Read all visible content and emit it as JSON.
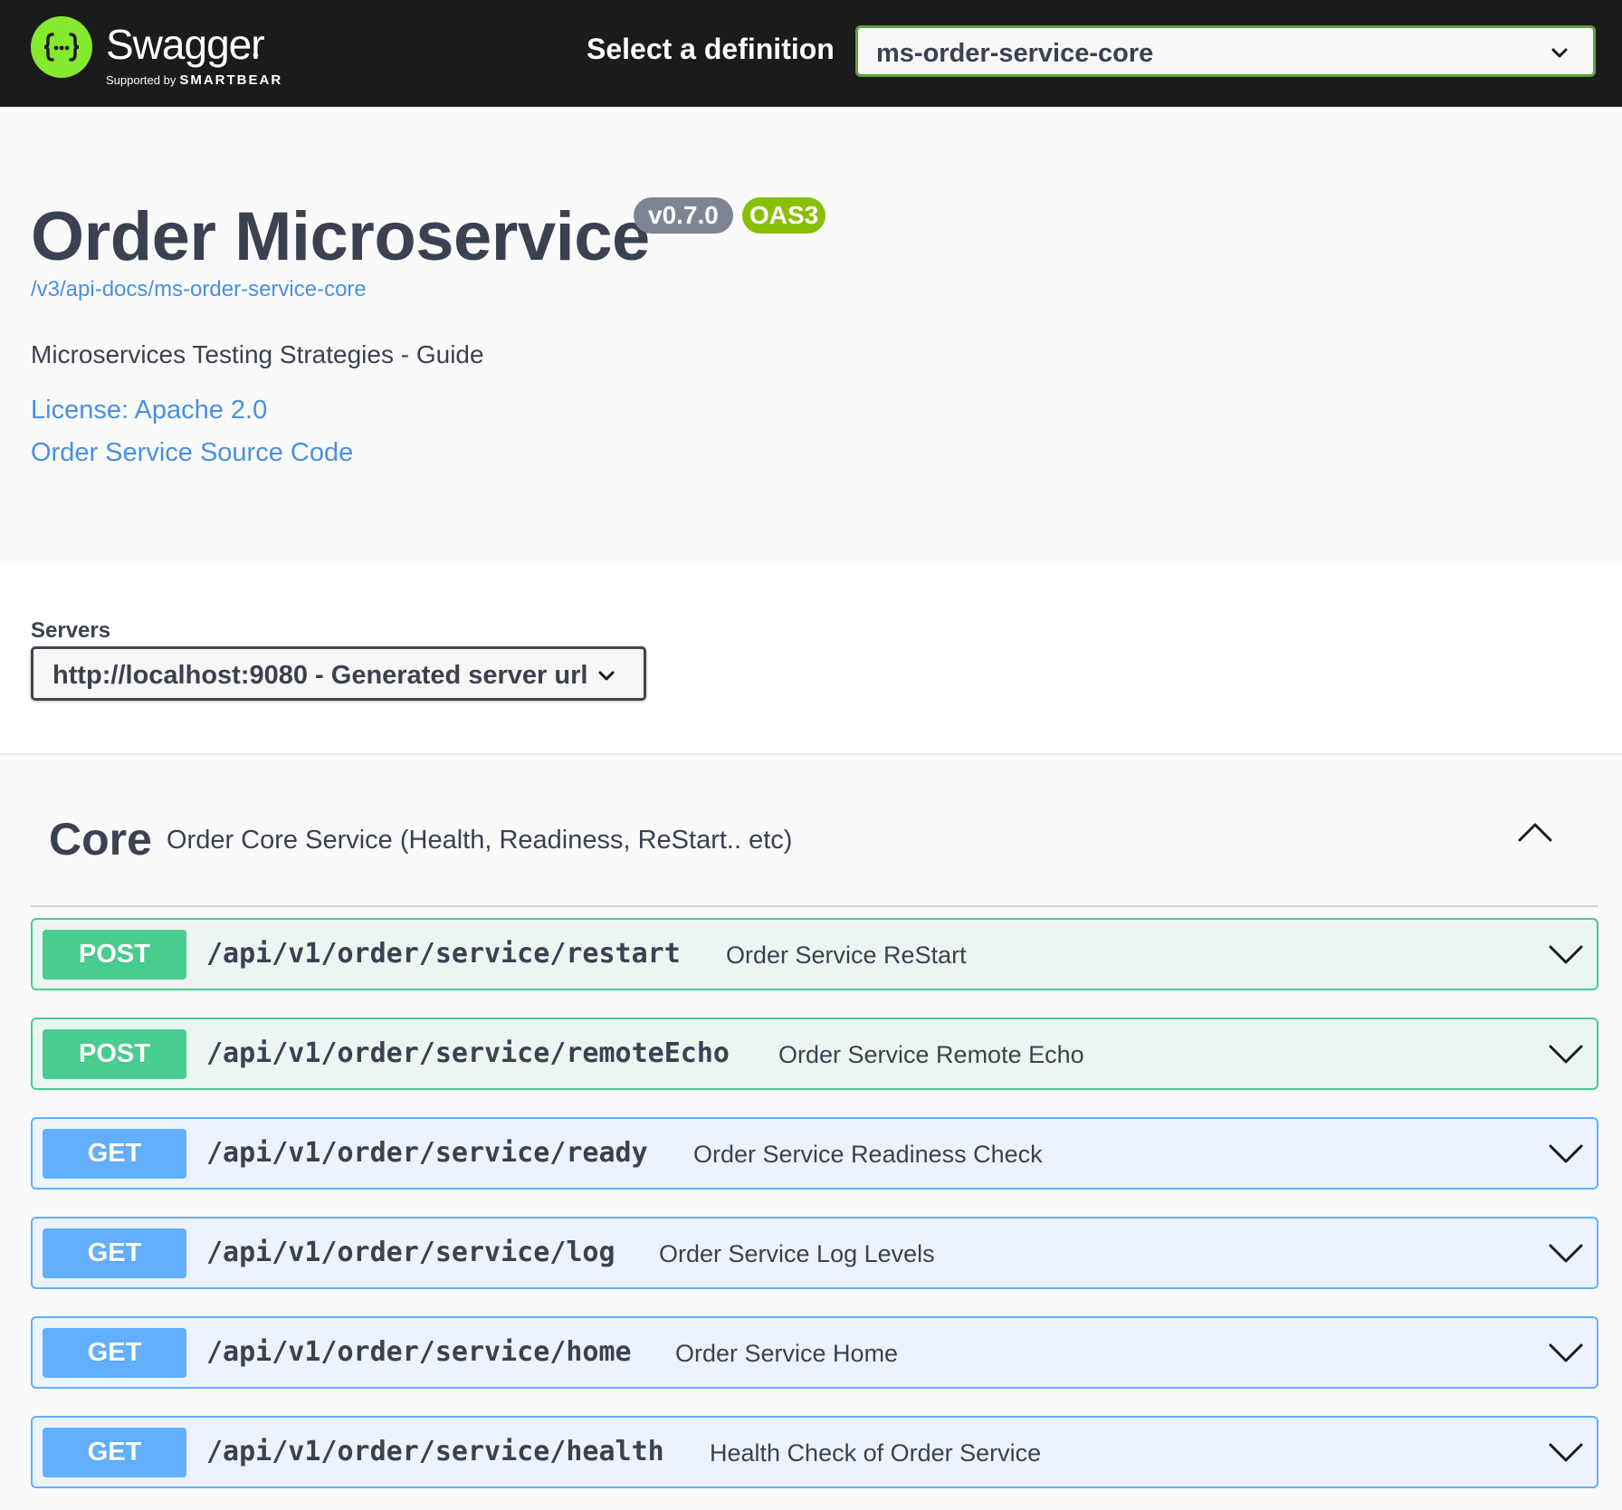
{
  "topbar": {
    "logo_text": "Swagger",
    "logo_tm": "™",
    "supported_by": "Supported by",
    "smartbear": "SMARTBEAR",
    "select_label": "Select a definition",
    "selected_definition": "ms-order-service-core"
  },
  "info": {
    "title": "Order Microservice",
    "version": "v0.7.0",
    "oas_badge": "OAS3",
    "api_url": "/v3/api-docs/ms-order-service-core",
    "description": "Microservices Testing Strategies - Guide",
    "license_link": "License: Apache 2.0",
    "source_link": "Order Service Source Code"
  },
  "servers": {
    "label": "Servers",
    "selected": "http://localhost:9080 - Generated server url"
  },
  "tag": {
    "name": "Core",
    "description": "Order Core Service (Health, Readiness, ReStart.. etc)"
  },
  "operations": [
    {
      "method": "POST",
      "path": "/api/v1/order/service/restart",
      "summary": "Order Service ReStart"
    },
    {
      "method": "POST",
      "path": "/api/v1/order/service/remoteEcho",
      "summary": "Order Service Remote Echo"
    },
    {
      "method": "GET",
      "path": "/api/v1/order/service/ready",
      "summary": "Order Service Readiness Check"
    },
    {
      "method": "GET",
      "path": "/api/v1/order/service/log",
      "summary": "Order Service Log Levels"
    },
    {
      "method": "GET",
      "path": "/api/v1/order/service/home",
      "summary": "Order Service Home"
    },
    {
      "method": "GET",
      "path": "/api/v1/order/service/health",
      "summary": "Health Check of Order Service"
    }
  ],
  "colors": {
    "topbar_bg": "#1b1b1b",
    "logo_green": "#85ea2d",
    "post_green": "#49cc90",
    "get_blue": "#61affe",
    "link_blue": "#4990e2",
    "oas_green": "#89bf04",
    "version_grey": "#7d8492"
  },
  "icons": {
    "logo": "swagger-braces-logo",
    "dropdown": "chevron-down-icon",
    "collapse": "chevron-up-icon",
    "expand": "chevron-down-icon"
  }
}
